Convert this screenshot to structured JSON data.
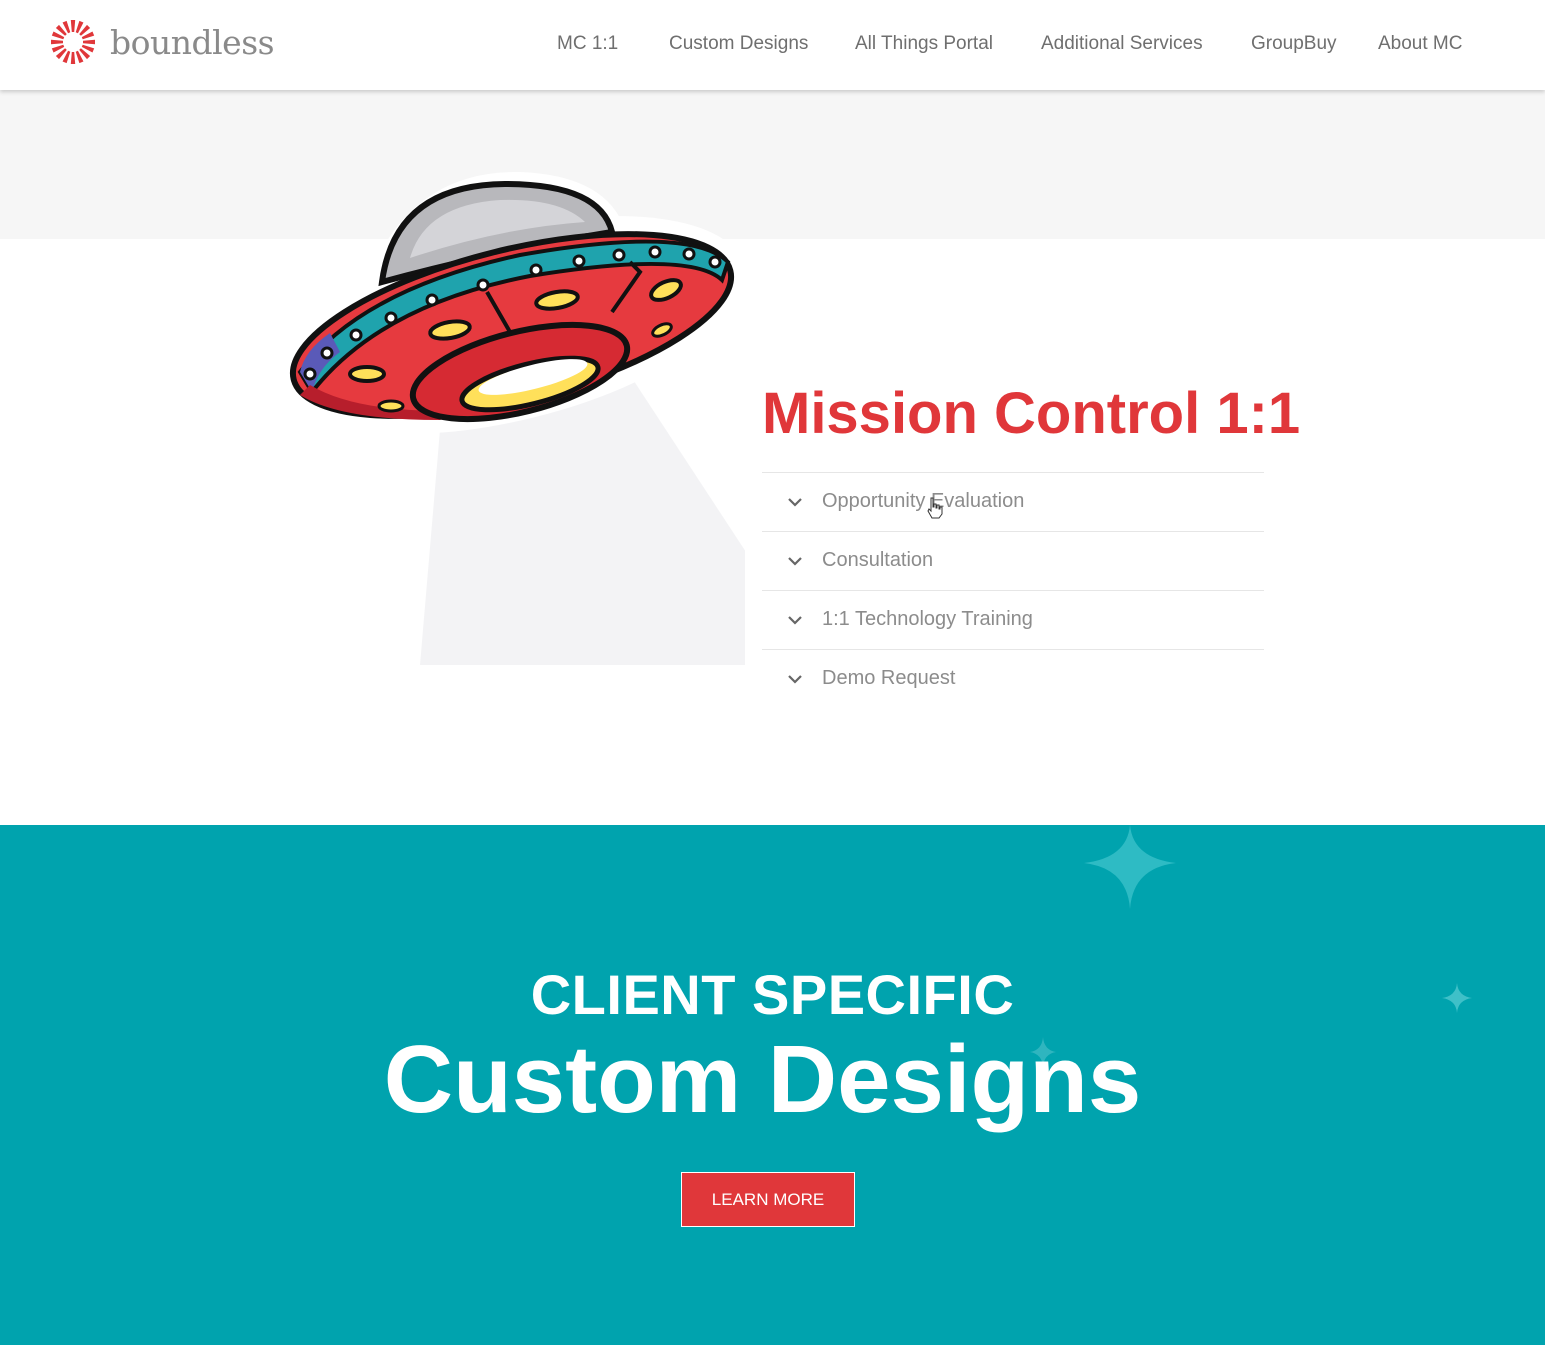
{
  "brand": {
    "name": "boundless",
    "color": "#e0373a"
  },
  "nav": {
    "items": [
      {
        "label": "MC 1:1"
      },
      {
        "label": "Custom Designs"
      },
      {
        "label": "All Things Portal"
      },
      {
        "label": "Additional Services"
      },
      {
        "label": "GroupBuy"
      },
      {
        "label": "About MC"
      }
    ]
  },
  "hero": {
    "title": "Mission Control 1:1",
    "illustration": "ufo-illustration",
    "accordion": [
      {
        "label": "Opportunity Evaluation",
        "icon": "chevron-down-icon"
      },
      {
        "label": "Consultation",
        "icon": "chevron-down-icon"
      },
      {
        "label": "1:1 Technology Training",
        "icon": "chevron-down-icon"
      },
      {
        "label": "Demo Request",
        "icon": "chevron-down-icon"
      }
    ]
  },
  "custom_designs": {
    "subtitle": "CLIENT SPECIFIC",
    "title": "Custom Designs",
    "button_label": "LEARN MORE",
    "background_color": "#00a3ae",
    "button_color": "#e0373a"
  }
}
